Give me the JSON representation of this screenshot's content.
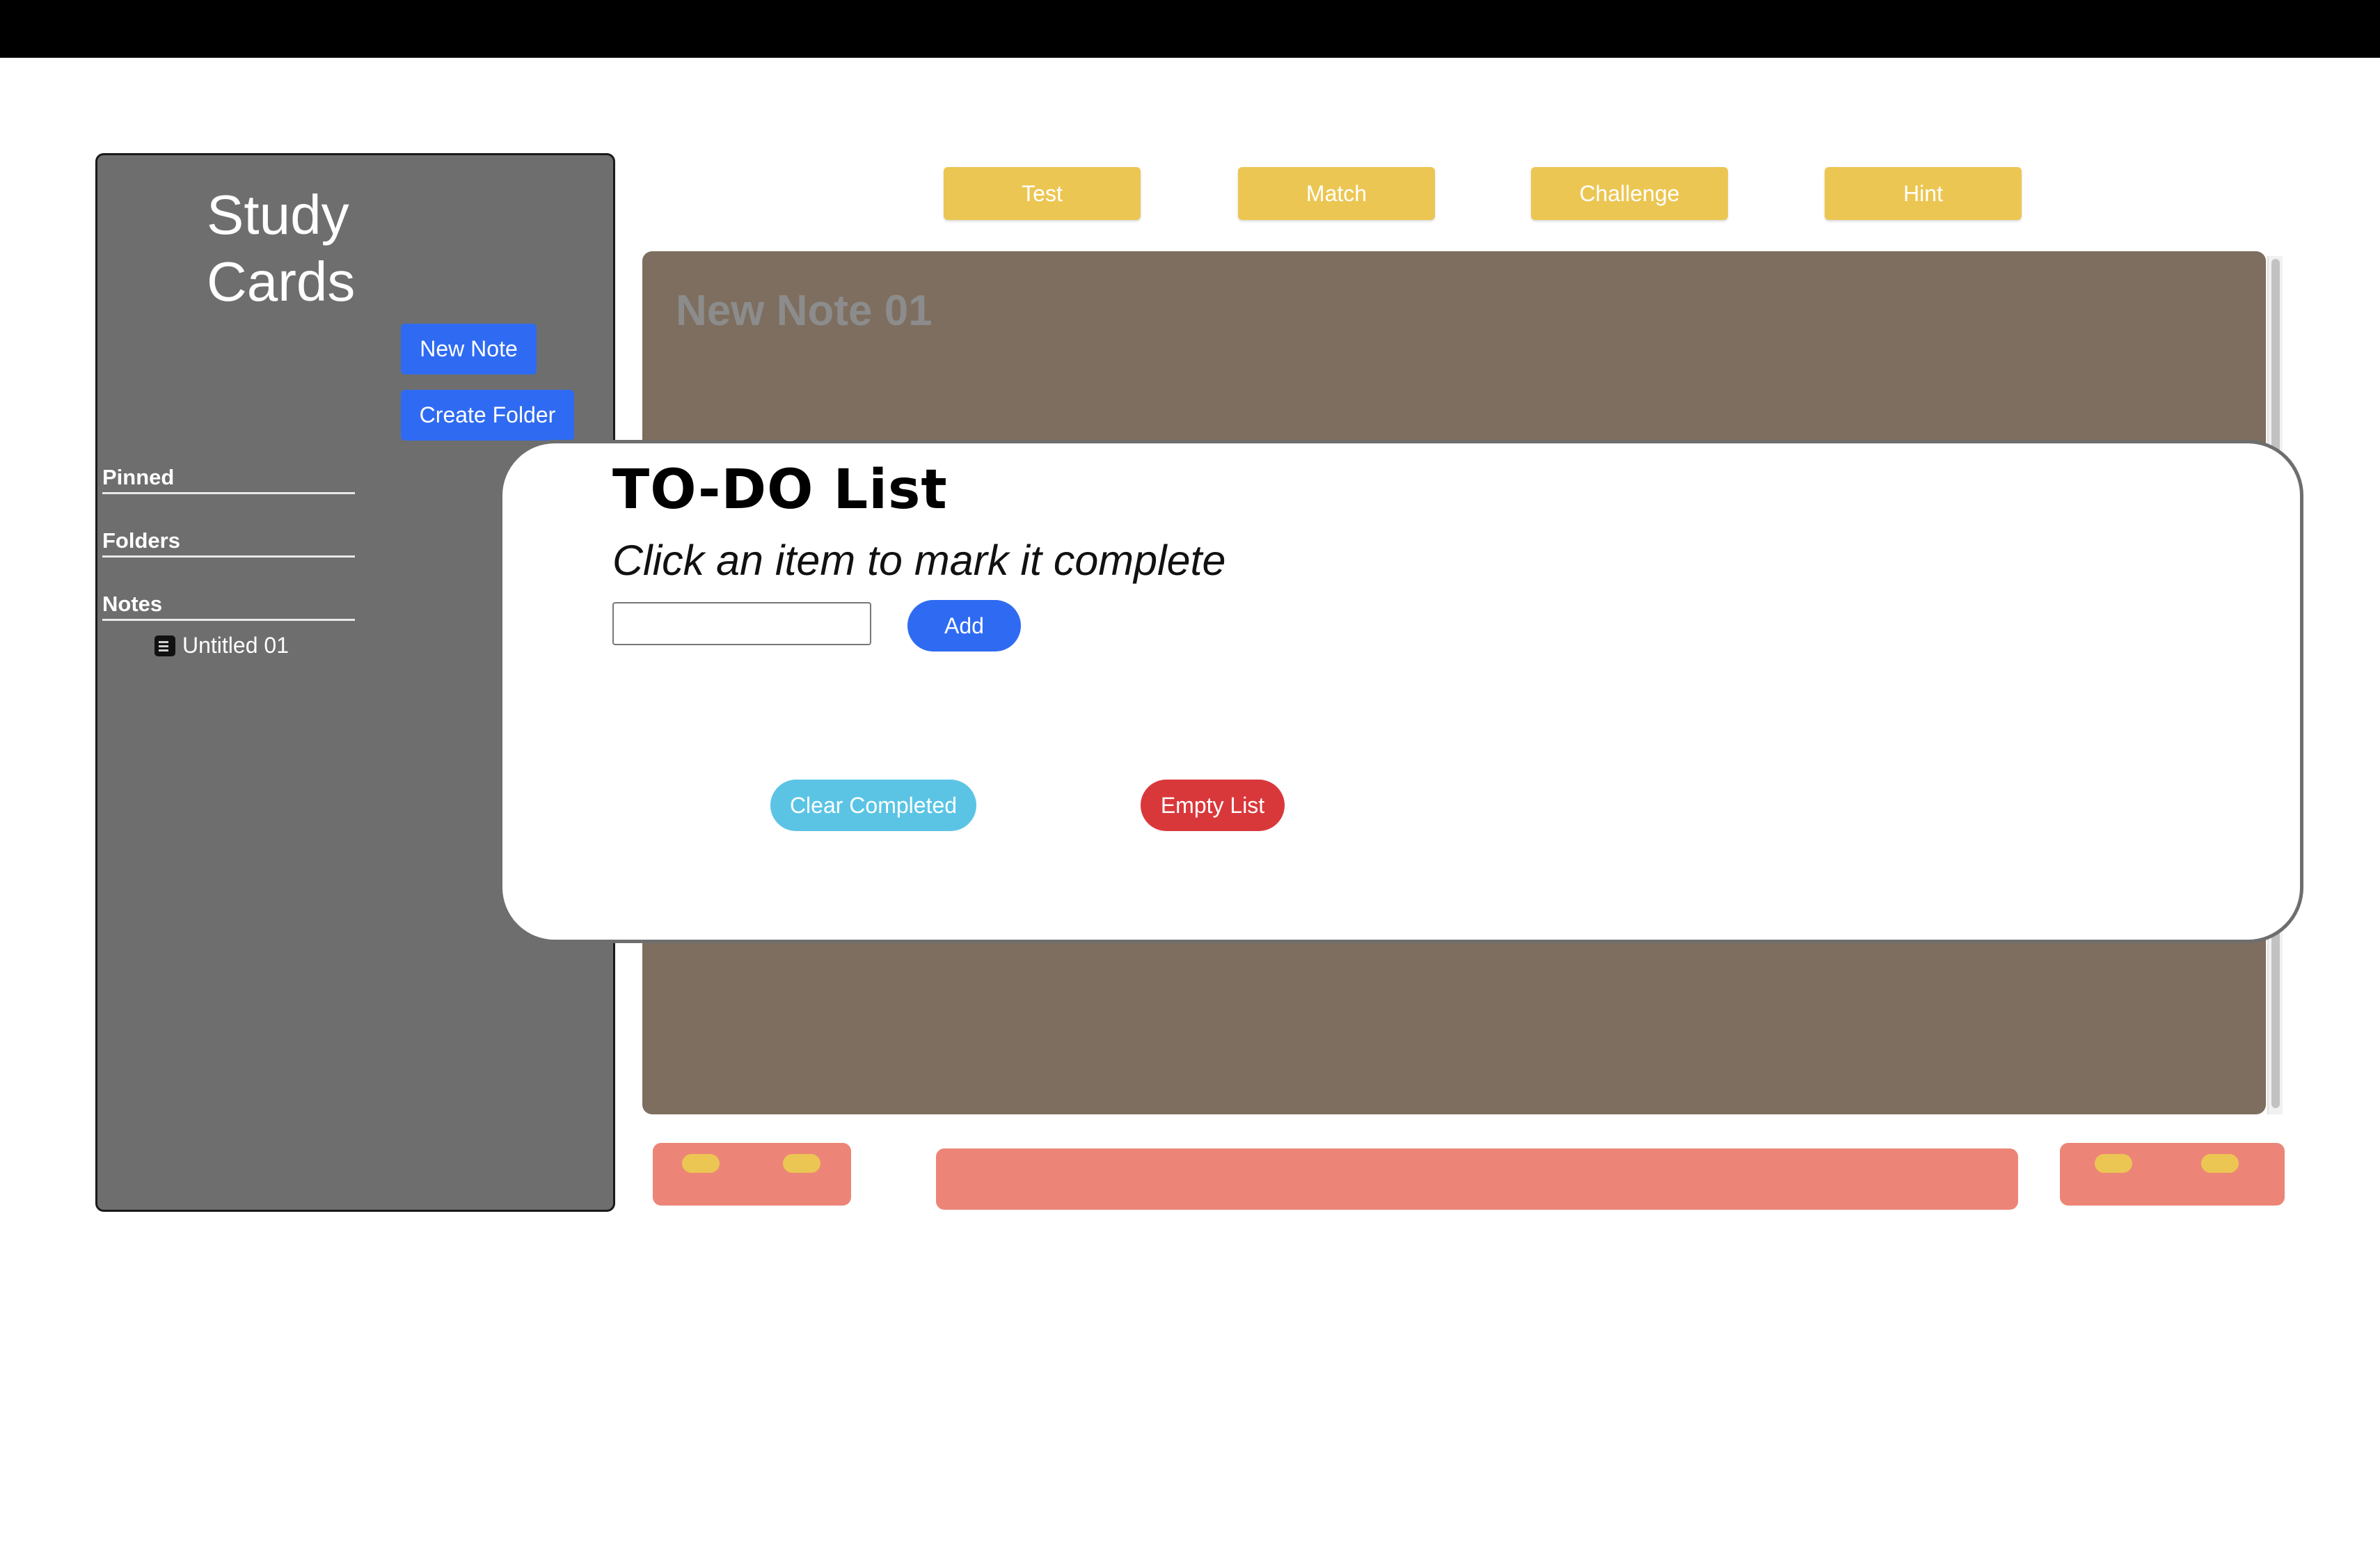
{
  "sidebar": {
    "title": "Study Cards",
    "new_note_label": "New Note",
    "create_folder_label": "Create Folder",
    "sections": {
      "pinned": "Pinned",
      "folders": "Folders",
      "notes": "Notes"
    },
    "notes": [
      {
        "label": "Untitled 01",
        "icon": "note-icon"
      }
    ]
  },
  "toolbar": {
    "test_label": "Test",
    "match_label": "Match",
    "challenge_label": "Challenge",
    "hint_label": "Hint"
  },
  "editor": {
    "title_placeholder": "New Note 01"
  },
  "todo": {
    "title": "TO-DO List",
    "subtitle": "Click an item to mark it complete",
    "input_value": "",
    "add_label": "Add",
    "clear_completed_label": "Clear Completed",
    "empty_list_label": "Empty List"
  },
  "colors": {
    "accent_blue": "#2f6bf2",
    "toolbar_yellow": "#ecc653",
    "sidebar_gray": "#6e6e6e",
    "editor_brown": "#7d6e5f",
    "footer_salmon": "#ec8577",
    "clear_cyan": "#5bc4e5",
    "empty_red": "#d9383b"
  }
}
